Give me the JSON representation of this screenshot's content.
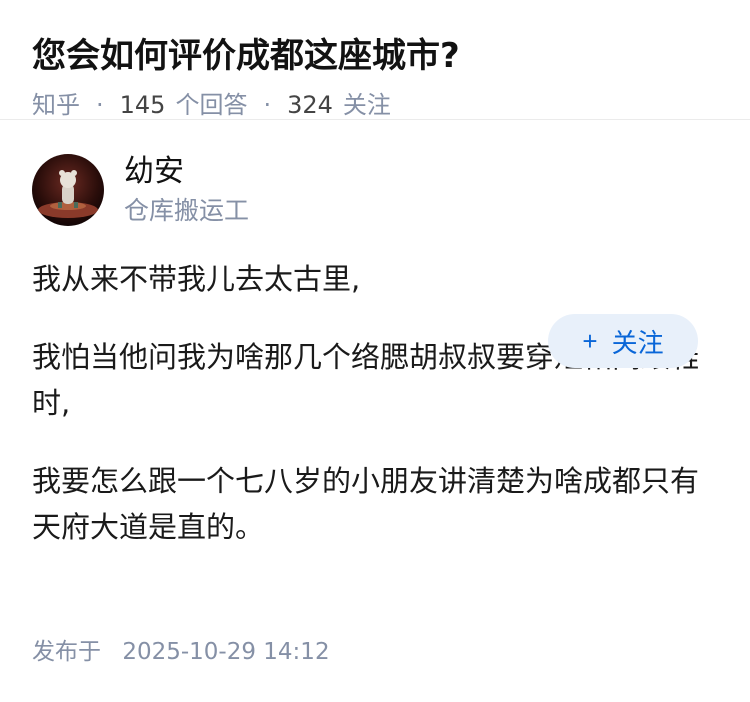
{
  "question": {
    "title": "您会如何评价成都这座城市?",
    "source": "知乎",
    "answer_count": "145",
    "answer_label": "个回答",
    "follower_count": "324",
    "follower_label": "关注",
    "separator": "·"
  },
  "author": {
    "name": "幼安",
    "headline": "仓库搬运工",
    "follow_icon": "plus-icon",
    "follow_plus": "+",
    "follow_label": "关注"
  },
  "answer": {
    "paragraphs": [
      "我从来不带我儿去太古里,",
      "我怕当他问我为啥那几个络腮胡叔叔要穿短裙高跟鞋时,",
      "我要怎么跟一个七八岁的小朋友讲清楚为啥成都只有天府大道是直的。"
    ],
    "publish_label": "发布于",
    "publish_time": "2025-10-29 14:12"
  },
  "colors": {
    "meta": "#8590a6",
    "follow_bg": "#e8f0fa",
    "follow_text": "#0966d8"
  }
}
